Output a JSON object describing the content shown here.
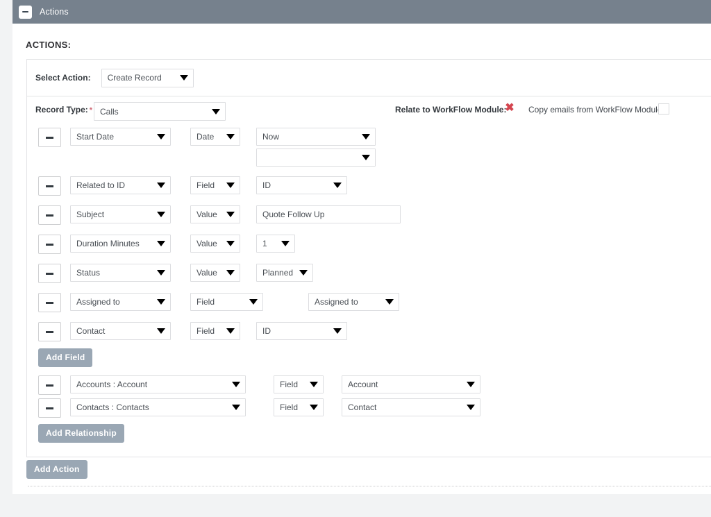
{
  "panel": {
    "title": "Actions",
    "collapse_icon": "minus-icon"
  },
  "section": {
    "heading": "ACTIONS:"
  },
  "select_action": {
    "label": "Select Action:",
    "value": "Create Record"
  },
  "record_type": {
    "label": "Record Type:",
    "required_marker": "*",
    "value": "Calls",
    "relate_label": "Relate to WorkFlow Module:",
    "relate_icon": "red-x-icon",
    "relate_glyph": "✖",
    "copy_label": "Copy emails from WorkFlow Module:",
    "copy_checked": false
  },
  "field_rows": [
    {
      "remove_label": "−",
      "field": "Start Date",
      "type": "Date",
      "value": "Now",
      "extra_value": "",
      "has_extra": true,
      "value_width": 172,
      "value_kind": "select"
    },
    {
      "remove_label": "−",
      "field": "Related to ID",
      "type": "Field",
      "value": "ID",
      "has_extra": false,
      "value_width": 131,
      "value_kind": "select"
    },
    {
      "remove_label": "−",
      "field": "Subject",
      "type": "Value",
      "value": "Quote Follow Up",
      "has_extra": false,
      "value_width": 208,
      "value_kind": "text"
    },
    {
      "remove_label": "−",
      "field": "Duration Minutes",
      "type": "Value",
      "value": "1",
      "has_extra": false,
      "value_width": 56,
      "value_kind": "select"
    },
    {
      "remove_label": "−",
      "field": "Status",
      "type": "Value",
      "value": "Planned",
      "has_extra": false,
      "value_width": 82,
      "value_kind": "select"
    },
    {
      "remove_label": "−",
      "field": "Assigned to",
      "type": "Field",
      "value": "Assigned to",
      "has_extra": false,
      "type_width": 105,
      "value_left": 405,
      "value_width": 131,
      "value_kind": "select"
    },
    {
      "remove_label": "−",
      "field": "Contact",
      "type": "Field",
      "value": "ID",
      "has_extra": false,
      "value_width": 131,
      "value_kind": "select"
    }
  ],
  "buttons": {
    "add_field": "Add Field",
    "add_relationship": "Add Relationship",
    "add_action": "Add Action"
  },
  "relationship_rows": [
    {
      "remove_label": "−",
      "relationship": "Accounts : Account",
      "type": "Field",
      "value": "Account"
    },
    {
      "remove_label": "−",
      "relationship": "Contacts : Contacts",
      "type": "Field",
      "value": "Contact"
    }
  ],
  "colors": {
    "header_bar": "#76818d",
    "button": "#9aa7b4",
    "required": "#d06a77",
    "red_x": "#d4454f",
    "page_bg": "#f2f3f4"
  }
}
